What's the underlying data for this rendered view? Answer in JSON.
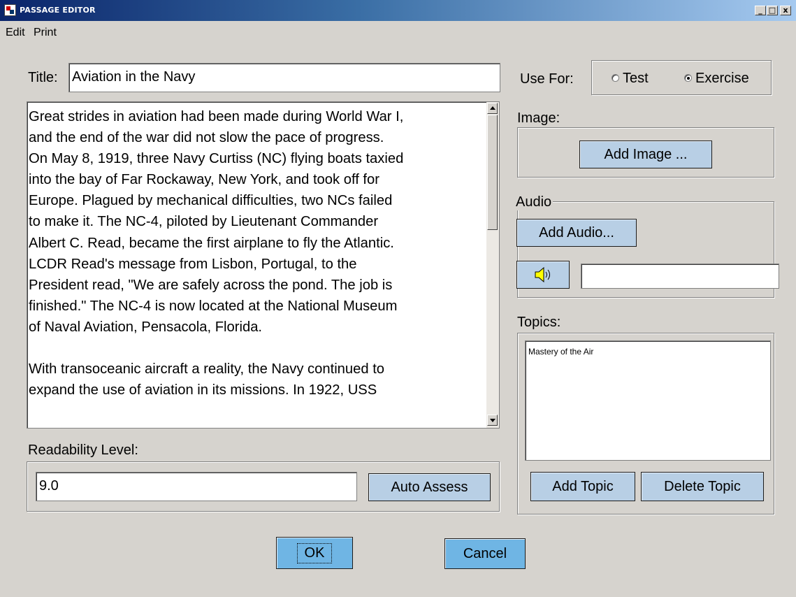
{
  "window": {
    "title": "PASSAGE EDITOR"
  },
  "window_controls": {
    "minimize": "_",
    "maximize": "□",
    "close": "x"
  },
  "menu": {
    "items": [
      "Edit",
      "Print"
    ]
  },
  "title_field": {
    "label": "Title:",
    "value": "Aviation in the Navy"
  },
  "use_for": {
    "label": "Use For:",
    "options": [
      "Test",
      "Exercise"
    ],
    "selected": "Exercise"
  },
  "passage": {
    "text": "Great strides in aviation had been made during World War I,\nand the end of the war did not slow the pace of progress.\nOn May 8, 1919, three Navy Curtiss (NC) flying boats taxied\ninto the bay of Far Rockaway, New York, and took off for\nEurope. Plagued by mechanical difficulties, two NCs failed\nto make it. The NC-4, piloted by Lieutenant Commander\nAlbert C. Read, became the first airplane to fly the Atlantic.\nLCDR Read's message from Lisbon, Portugal, to the\nPresident read, \"We are safely across the pond. The job is\nfinished.\" The NC-4 is now located at the National Museum\nof Naval Aviation, Pensacola, Florida.\n\nWith transoceanic aircraft a reality, the Navy continued to\nexpand the use of aviation in its missions. In 1922, USS"
  },
  "image_section": {
    "label": "Image:",
    "button": "Add Image ..."
  },
  "audio_section": {
    "label": "Audio",
    "button": "Add Audio...",
    "file_value": ""
  },
  "topics": {
    "label": "Topics:",
    "items": [
      "Mastery of the Air"
    ],
    "add_button": "Add Topic",
    "delete_button": "Delete Topic"
  },
  "readability": {
    "label": "Readability Level:",
    "value": "9.0",
    "button": "Auto Assess"
  },
  "dialog_buttons": {
    "ok": "OK",
    "cancel": "Cancel"
  },
  "colors": {
    "button_face": "#b8cfe5",
    "default_button": "#6fb5e4",
    "window_bg": "#d6d3ce",
    "titlebar": "#0a246a"
  }
}
